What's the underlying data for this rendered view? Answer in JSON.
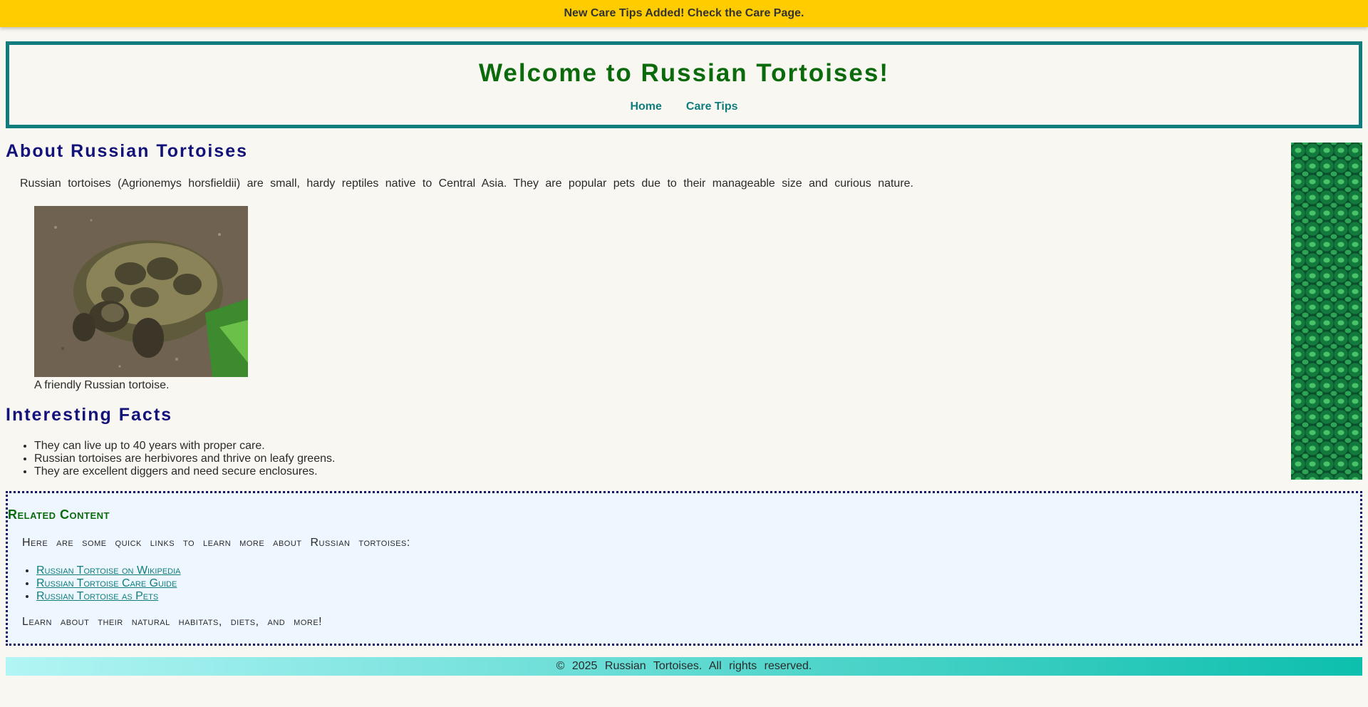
{
  "banner": {
    "text": "New Care Tips Added! Check the Care Page."
  },
  "header": {
    "title": "Welcome to Russian Tortoises!",
    "nav": [
      {
        "label": "Home"
      },
      {
        "label": "Care Tips"
      }
    ]
  },
  "about": {
    "title": "About Russian Tortoises",
    "text": "Russian tortoises (Agrionemys horsfieldii) are small, hardy reptiles native to Central Asia. They are popular pets due to their manageable size and curious nature.",
    "image_caption": "A friendly Russian tortoise."
  },
  "facts": {
    "title": "Interesting Facts",
    "items": [
      "They can live up to 40 years with proper care.",
      "Russian tortoises are herbivores and thrive on leafy greens.",
      "They are excellent diggers and need secure enclosures."
    ]
  },
  "related": {
    "title": "Related Content",
    "intro": "Here are some quick links to learn more about Russian tortoises:",
    "links": [
      "Russian Tortoise on Wikipedia",
      "Russian Tortoise Care Guide",
      "Russian Tortoise as Pets"
    ],
    "outro": "Learn about their natural habitats, diets, and more!"
  },
  "footer": {
    "text": "© 2025 Russian Tortoises. All rights reserved."
  },
  "colors": {
    "banner": "#ffcc00",
    "header_border": "#0f7d7d",
    "header_title": "#0b6a0b",
    "section_title": "#12127a",
    "related_bg": "#eef7ff",
    "footer_gradient_start": "#b2f5f5",
    "footer_gradient_end": "#0dbfae"
  }
}
